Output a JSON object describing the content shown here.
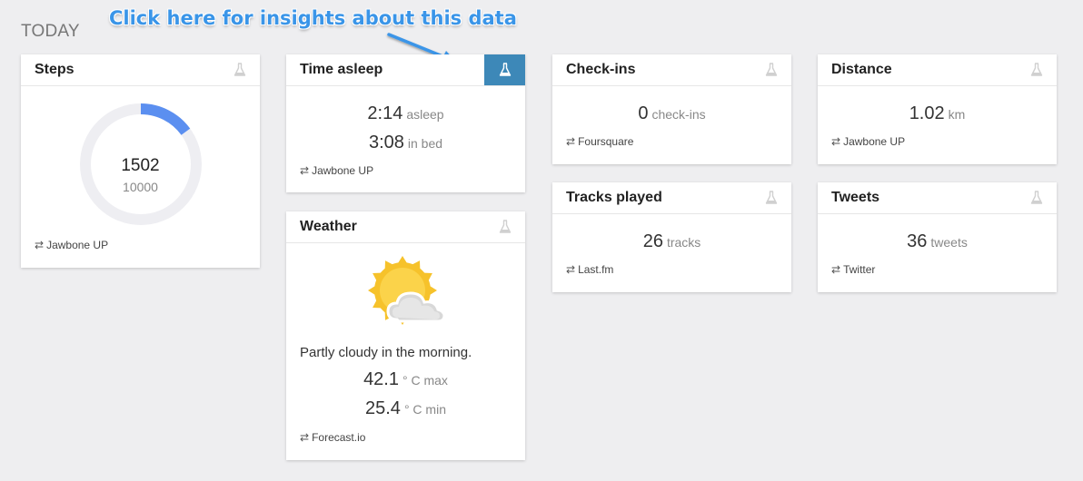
{
  "section_title": "TODAY",
  "annotation": "Click here for insights about this data",
  "colors": {
    "accent": "#3d88b8",
    "ring": "#5b8ff0",
    "ring_track": "#eeeef2",
    "sun": "#f6c22b"
  },
  "cards": {
    "steps": {
      "title": "Steps",
      "value": "1502",
      "goal": "10000",
      "progress": 0.1502,
      "source": "Jawbone UP"
    },
    "sleep": {
      "title": "Time asleep",
      "asleep_value": "2:14",
      "asleep_unit": "asleep",
      "bed_value": "3:08",
      "bed_unit": "in bed",
      "source": "Jawbone UP"
    },
    "weather": {
      "title": "Weather",
      "icon": "partly-cloudy-icon",
      "summary": "Partly cloudy in the morning.",
      "max_value": "42.1",
      "max_unit": "° C max",
      "min_value": "25.4",
      "min_unit": "° C min",
      "source": "Forecast.io"
    },
    "checkins": {
      "title": "Check-ins",
      "value": "0",
      "unit": "check-ins",
      "source": "Foursquare"
    },
    "distance": {
      "title": "Distance",
      "value": "1.02",
      "unit": "km",
      "source": "Jawbone UP"
    },
    "tracks": {
      "title": "Tracks played",
      "value": "26",
      "unit": "tracks",
      "source": "Last.fm"
    },
    "tweets": {
      "title": "Tweets",
      "value": "36",
      "unit": "tweets",
      "source": "Twitter"
    }
  }
}
